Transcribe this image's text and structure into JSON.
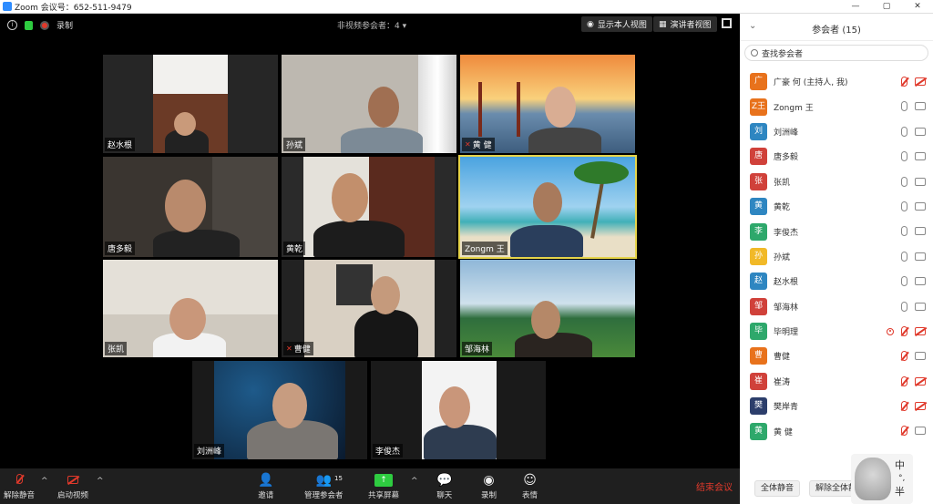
{
  "window": {
    "title": "Zoom 会议号：652-511-9479",
    "controls": [
      "—",
      "▢",
      "✕"
    ]
  },
  "top_bar": {
    "record_label": "录制",
    "non_video_label": "非视频参会者：4 ▾",
    "self_view_label": "显示本人视图",
    "speaker_view_label": "演讲者视图"
  },
  "tiles": [
    {
      "name": "赵水根",
      "muted": false
    },
    {
      "name": "孙斌",
      "muted": false
    },
    {
      "name": "黄 健",
      "muted": true
    },
    {
      "name": "唐多毅",
      "muted": false
    },
    {
      "name": "黄乾",
      "muted": false
    },
    {
      "name": "Zongm 王",
      "muted": false,
      "active": true
    },
    {
      "name": "张凯",
      "muted": false
    },
    {
      "name": "曹健",
      "muted": true
    },
    {
      "name": "邹海林",
      "muted": false
    },
    {
      "name": "刘洲峰",
      "muted": false
    },
    {
      "name": "李俊杰",
      "muted": false
    }
  ],
  "toolbar": {
    "unmute": "解除静音",
    "start_video": "启动视频",
    "invite": "邀请",
    "manage": "管理参会者",
    "participant_count": "15",
    "share": "共享屏幕",
    "chat": "聊天",
    "record": "录制",
    "reactions": "表情",
    "end": "结束会议"
  },
  "panel": {
    "title": "参会者 (15)",
    "search_placeholder": "查找参会者",
    "mute_all": "全体静音",
    "unmute_all": "解除全体静音",
    "participants": [
      {
        "avatar": "广",
        "name": "广豪 何 (主持人, 我)",
        "color": "#e8721c",
        "mic": "off",
        "cam": "off"
      },
      {
        "avatar": "Z王",
        "name": "Zongm 王",
        "color": "#e8721c",
        "mic": "on",
        "cam": "on"
      },
      {
        "avatar": "刘",
        "name": "刘洲峰",
        "color": "#2e86c1",
        "mic": "on",
        "cam": "on"
      },
      {
        "avatar": "唐",
        "name": "唐多毅",
        "color": "#d0413a",
        "mic": "on",
        "cam": "on"
      },
      {
        "avatar": "张",
        "name": "张凯",
        "color": "#d0413a",
        "mic": "on",
        "cam": "on"
      },
      {
        "avatar": "黄",
        "name": "黄乾",
        "color": "#2e86c1",
        "mic": "on",
        "cam": "on"
      },
      {
        "avatar": "李",
        "name": "李俊杰",
        "color": "#2ea86b",
        "mic": "on",
        "cam": "on"
      },
      {
        "avatar": "孙",
        "name": "孙斌",
        "color": "#f1b928",
        "mic": "on",
        "cam": "on"
      },
      {
        "avatar": "赵",
        "name": "赵水根",
        "color": "#2e86c1",
        "mic": "on",
        "cam": "on"
      },
      {
        "avatar": "邹",
        "name": "邹海林",
        "color": "#d0413a",
        "mic": "on",
        "cam": "on"
      },
      {
        "avatar": "毕",
        "name": "毕明理",
        "color": "#2ea86b",
        "mic": "off",
        "cam": "off",
        "recording": true
      },
      {
        "avatar": "曹",
        "name": "曹健",
        "color": "#e8721c",
        "mic": "off",
        "cam": "on"
      },
      {
        "avatar": "崔",
        "name": "崔涛",
        "color": "#d0413a",
        "mic": "off",
        "cam": "off"
      },
      {
        "avatar": "樊",
        "name": "樊岸青",
        "color": "#2c3e6b",
        "mic": "off",
        "cam": "off"
      },
      {
        "avatar": "黄",
        "name": "黄 健",
        "color": "#2ea86b",
        "mic": "off",
        "cam": "on"
      }
    ]
  },
  "ime": {
    "char1": "中",
    "char2": "半"
  }
}
